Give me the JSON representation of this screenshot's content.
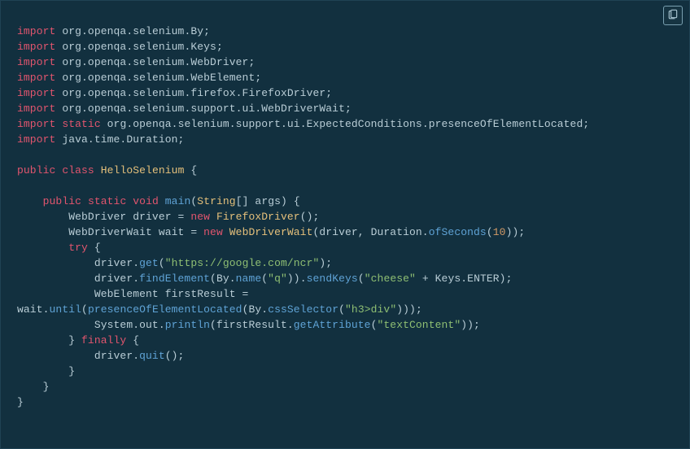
{
  "code": {
    "lines": [
      [
        [
          "kw",
          "import"
        ],
        [
          "punc",
          " org.openqa.selenium.By;"
        ]
      ],
      [
        [
          "kw",
          "import"
        ],
        [
          "punc",
          " org.openqa.selenium.Keys;"
        ]
      ],
      [
        [
          "kw",
          "import"
        ],
        [
          "punc",
          " org.openqa.selenium.WebDriver;"
        ]
      ],
      [
        [
          "kw",
          "import"
        ],
        [
          "punc",
          " org.openqa.selenium.WebElement;"
        ]
      ],
      [
        [
          "kw",
          "import"
        ],
        [
          "punc",
          " org.openqa.selenium.firefox.FirefoxDriver;"
        ]
      ],
      [
        [
          "kw",
          "import"
        ],
        [
          "punc",
          " org.openqa.selenium.support.ui.WebDriverWait;"
        ]
      ],
      [
        [
          "kw",
          "import"
        ],
        [
          "punc",
          " "
        ],
        [
          "kw",
          "static"
        ],
        [
          "punc",
          " org.openqa.selenium.support.ui.ExpectedConditions.presenceOfElementLocated;"
        ]
      ],
      [
        [
          "kw",
          "import"
        ],
        [
          "punc",
          " java.time.Duration;"
        ]
      ],
      [
        [
          "punc",
          ""
        ]
      ],
      [
        [
          "kw",
          "public"
        ],
        [
          "punc",
          " "
        ],
        [
          "kw",
          "class"
        ],
        [
          "punc",
          " "
        ],
        [
          "typeY",
          "HelloSelenium"
        ],
        [
          "punc",
          " {"
        ]
      ],
      [
        [
          "punc",
          ""
        ]
      ],
      [
        [
          "punc",
          "    "
        ],
        [
          "kw",
          "public"
        ],
        [
          "punc",
          " "
        ],
        [
          "kw",
          "static"
        ],
        [
          "punc",
          " "
        ],
        [
          "kw",
          "void"
        ],
        [
          "punc",
          " "
        ],
        [
          "func",
          "main"
        ],
        [
          "punc",
          "("
        ],
        [
          "typeY",
          "String"
        ],
        [
          "punc",
          "[] args) {"
        ]
      ],
      [
        [
          "punc",
          "        WebDriver driver = "
        ],
        [
          "kw",
          "new"
        ],
        [
          "punc",
          " "
        ],
        [
          "typeY",
          "FirefoxDriver"
        ],
        [
          "punc",
          "();"
        ]
      ],
      [
        [
          "punc",
          "        WebDriverWait wait = "
        ],
        [
          "kw",
          "new"
        ],
        [
          "punc",
          " "
        ],
        [
          "typeY",
          "WebDriverWait"
        ],
        [
          "punc",
          "(driver, Duration."
        ],
        [
          "func",
          "ofSeconds"
        ],
        [
          "punc",
          "("
        ],
        [
          "num",
          "10"
        ],
        [
          "punc",
          "));"
        ]
      ],
      [
        [
          "punc",
          "        "
        ],
        [
          "kw",
          "try"
        ],
        [
          "punc",
          " {"
        ]
      ],
      [
        [
          "punc",
          "            driver."
        ],
        [
          "func",
          "get"
        ],
        [
          "punc",
          "("
        ],
        [
          "str",
          "\"https://google.com/ncr\""
        ],
        [
          "punc",
          ");"
        ]
      ],
      [
        [
          "punc",
          "            driver."
        ],
        [
          "func",
          "findElement"
        ],
        [
          "punc",
          "(By."
        ],
        [
          "func",
          "name"
        ],
        [
          "punc",
          "("
        ],
        [
          "str",
          "\"q\""
        ],
        [
          "punc",
          "))."
        ],
        [
          "func",
          "sendKeys"
        ],
        [
          "punc",
          "("
        ],
        [
          "str",
          "\"cheese\""
        ],
        [
          "punc",
          " + Keys.ENTER);"
        ]
      ],
      [
        [
          "punc",
          "            WebElement firstResult ="
        ]
      ],
      [
        [
          "punc",
          "wait."
        ],
        [
          "func",
          "until"
        ],
        [
          "punc",
          "("
        ],
        [
          "func",
          "presenceOfElementLocated"
        ],
        [
          "punc",
          "(By."
        ],
        [
          "func",
          "cssSelector"
        ],
        [
          "punc",
          "("
        ],
        [
          "str",
          "\"h3>div\""
        ],
        [
          "punc",
          ")));"
        ]
      ],
      [
        [
          "punc",
          "            System.out."
        ],
        [
          "func",
          "println"
        ],
        [
          "punc",
          "(firstResult."
        ],
        [
          "func",
          "getAttribute"
        ],
        [
          "punc",
          "("
        ],
        [
          "str",
          "\"textContent\""
        ],
        [
          "punc",
          "));"
        ]
      ],
      [
        [
          "punc",
          "        } "
        ],
        [
          "kw",
          "finally"
        ],
        [
          "punc",
          " {"
        ]
      ],
      [
        [
          "punc",
          "            driver."
        ],
        [
          "func",
          "quit"
        ],
        [
          "punc",
          "();"
        ]
      ],
      [
        [
          "punc",
          "        }"
        ]
      ],
      [
        [
          "punc",
          "    }"
        ]
      ],
      [
        [
          "punc",
          "}"
        ]
      ]
    ]
  },
  "ui": {
    "copy_tooltip": "Copy"
  }
}
